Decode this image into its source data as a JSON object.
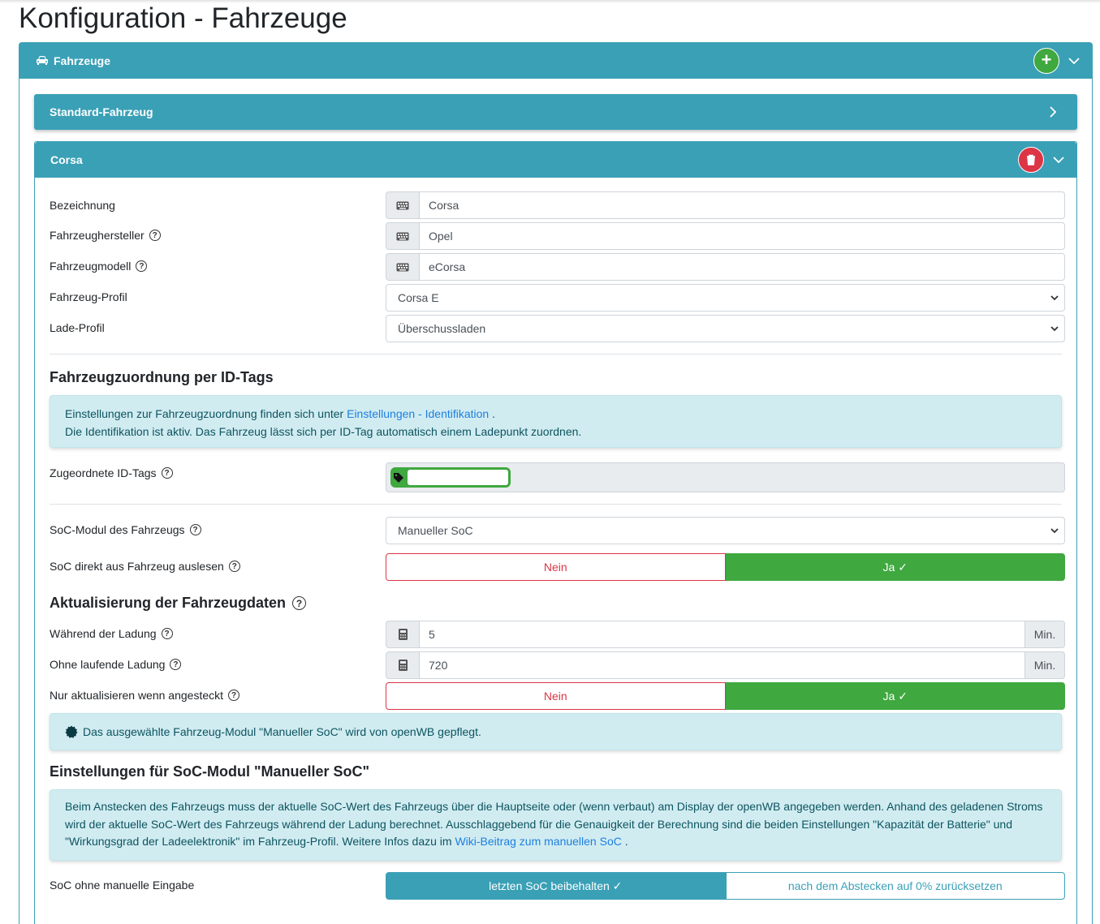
{
  "page": {
    "title": "Konfiguration - Fahrzeuge"
  },
  "outer": {
    "header": "Fahrzeuge",
    "add_symbol": "+"
  },
  "standard": {
    "header": "Standard-Fahrzeug"
  },
  "corsa": {
    "header": "Corsa",
    "fields": {
      "bezeichnung_label": "Bezeichnung",
      "bezeichnung_value": "Corsa",
      "hersteller_label": "Fahrzeughersteller",
      "hersteller_value": "Opel",
      "modell_label": "Fahrzeugmodell",
      "modell_value": "eCorsa",
      "profil_label": "Fahrzeug-Profil",
      "profil_value": "Corsa E",
      "lade_label": "Lade-Profil",
      "lade_value": "Überschussladen"
    },
    "idtags": {
      "title": "Fahrzeugzuordnung per ID-Tags",
      "info_prefix": "Einstellungen zur Fahrzeugzuordnung finden sich unter ",
      "info_link": "Einstellungen - Identifikation",
      "info_suffix": " .",
      "info_line2": "Die Identifikation ist aktiv. Das Fahrzeug lässt sich per ID-Tag automatisch einem Ladepunkt zuordnen.",
      "label": "Zugeordnete ID-Tags"
    },
    "soc": {
      "modul_label": "SoC-Modul des Fahrzeugs",
      "modul_value": "Manueller SoC",
      "direkt_label": "SoC direkt aus Fahrzeug auslesen",
      "nein": "Nein",
      "ja": "Ja ✓"
    },
    "update": {
      "title": "Aktualisierung der Fahrzeugdaten",
      "waehrend_label": "Während der Ladung",
      "waehrend_value": "5",
      "ohne_label": "Ohne laufende Ladung",
      "ohne_value": "720",
      "unit": "Min.",
      "nur_label": "Nur aktualisieren wenn angesteckt",
      "nein": "Nein",
      "ja": "Ja ✓",
      "module_info": "Das ausgewählte Fahrzeug-Modul \"Manueller SoC\" wird von openWB gepflegt."
    },
    "manual": {
      "title": "Einstellungen für SoC-Modul \"Manueller SoC\"",
      "info_text": "Beim Anstecken des Fahrzeugs muss der aktuelle SoC-Wert des Fahrzeugs über die Hauptseite oder (wenn verbaut) am Display der openWB angegeben werden. Anhand des geladenen Stroms wird der aktuelle SoC-Wert des Fahrzeugs während der Ladung berechnet. Ausschlaggebend für die Genauigkeit der Berechnung sind die beiden Einstellungen \"Kapazität der Batterie\" und \"Wirkungsgrad der Ladeelektronik\" im Fahrzeug-Profil. Weitere Infos dazu im ",
      "info_link": "Wiki-Beitrag zum manuellen SoC",
      "info_suffix": " .",
      "ohne_label": "SoC ohne manuelle Eingabe",
      "opt1": "letzten SoC beibehalten ✓",
      "opt2": "nach dem Abstecken auf 0% zurücksetzen"
    }
  }
}
